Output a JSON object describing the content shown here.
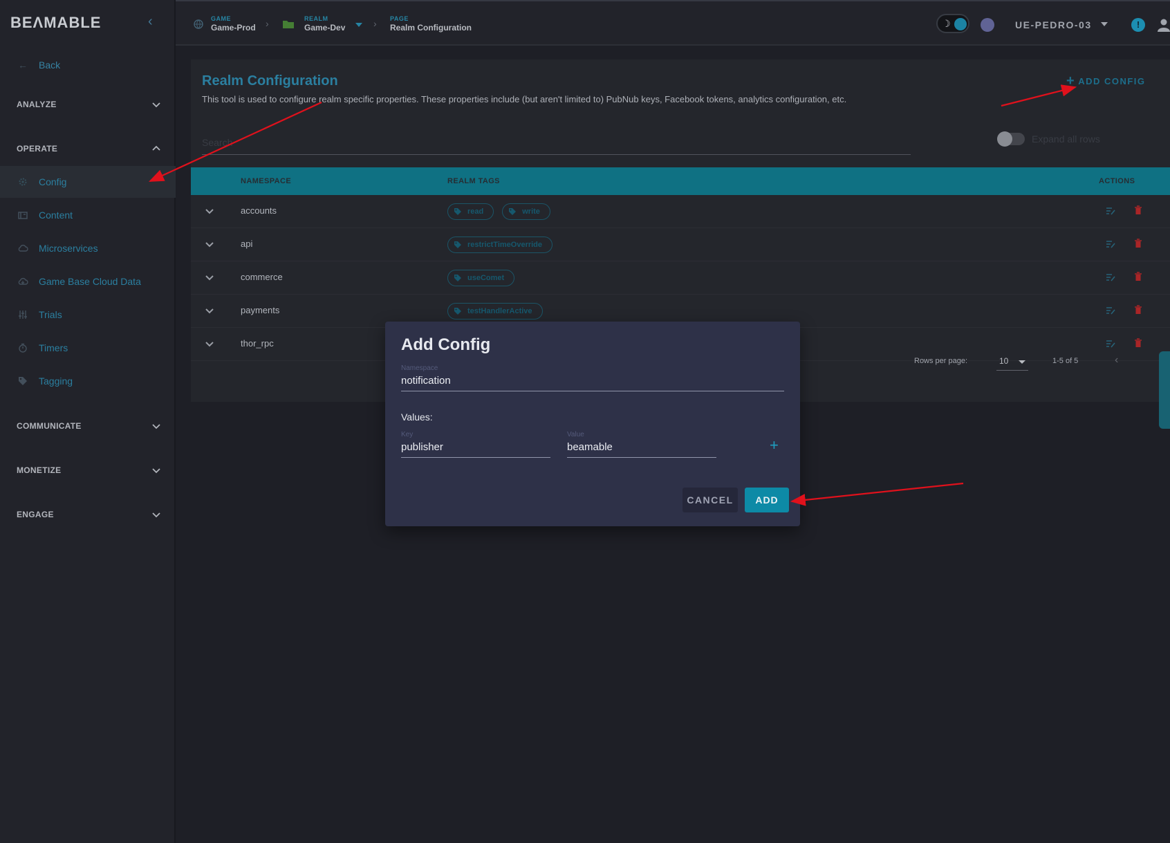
{
  "app": {
    "logo": "BEΛMABLE"
  },
  "sidebar": {
    "back_label": "Back",
    "sections": [
      {
        "label": "ANALYZE",
        "expanded": false
      },
      {
        "label": "OPERATE",
        "expanded": true
      },
      {
        "label": "COMMUNICATE",
        "expanded": false
      },
      {
        "label": "MONETIZE",
        "expanded": false
      },
      {
        "label": "ENGAGE",
        "expanded": false
      }
    ],
    "items": [
      {
        "label": "Config",
        "icon": "gear-icon",
        "active": true
      },
      {
        "label": "Content",
        "icon": "content-icon"
      },
      {
        "label": "Microservices",
        "icon": "cloud-icon"
      },
      {
        "label": "Game Base Cloud Data",
        "icon": "cloud-data-icon"
      },
      {
        "label": "Trials",
        "icon": "sliders-icon"
      },
      {
        "label": "Timers",
        "icon": "timer-icon"
      },
      {
        "label": "Tagging",
        "icon": "tag-icon"
      }
    ]
  },
  "topbar": {
    "breadcrumbs": [
      {
        "label": "GAME",
        "value": "Game-Prod"
      },
      {
        "label": "REALM",
        "value": "Game-Dev"
      },
      {
        "label": "PAGE",
        "value": "Realm Configuration"
      }
    ],
    "user": "UE-PEDRO-03",
    "alert_symbol": "!"
  },
  "main": {
    "title": "Realm Configuration",
    "description": "This tool is used to configure realm specific properties. These properties include (but aren't limited to) PubNub keys, Facebook tokens, analytics configuration, etc.",
    "add_config_label": "ADD CONFIG",
    "search_placeholder": "Search",
    "expand_all_label": "Expand all rows",
    "table": {
      "headers": [
        "NAMESPACE",
        "REALM TAGS",
        "ACTIONS"
      ],
      "rows": [
        {
          "namespace": "accounts",
          "tags": [
            "read",
            "write"
          ]
        },
        {
          "namespace": "api",
          "tags": [
            "restrictTimeOverride"
          ]
        },
        {
          "namespace": "commerce",
          "tags": [
            "useComet"
          ]
        },
        {
          "namespace": "payments",
          "tags": [
            "testHandlerActive"
          ]
        },
        {
          "namespace": "thor_rpc",
          "tags": []
        }
      ]
    },
    "pagination": {
      "rows_per_page_label": "Rows per page:",
      "rows_per_page": "10",
      "range": "1-5 of 5"
    }
  },
  "modal": {
    "title": "Add Config",
    "namespace_label": "Namespace",
    "namespace_value": "notification",
    "values_label": "Values:",
    "key_label": "Key",
    "key_value": "publisher",
    "value_label": "Value",
    "value_value": "beamable",
    "cancel_label": "CANCEL",
    "add_label": "ADD"
  },
  "colors": {
    "accent": "#0f7f93",
    "link": "#2f8fb4",
    "danger": "#c0282b",
    "annotation_arrow": "#e0111c"
  }
}
